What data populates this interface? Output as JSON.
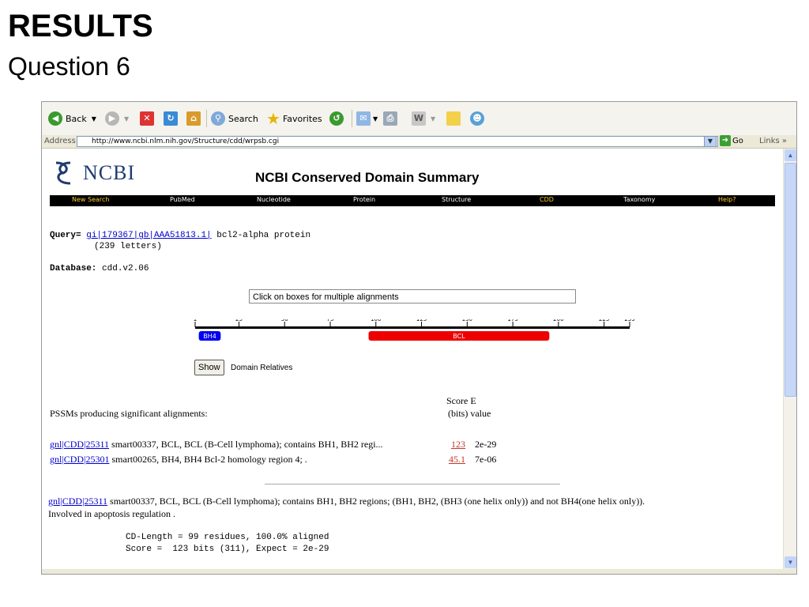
{
  "slide": {
    "title": "RESULTS",
    "subtitle": "Question 6"
  },
  "toolbar": {
    "back": "Back",
    "search": "Search",
    "favorites": "Favorites"
  },
  "address": {
    "label": "Address",
    "url": "http://www.ncbi.nlm.nih.gov/Structure/cdd/wrpsb.cgi",
    "go": "Go",
    "links": "Links"
  },
  "page": {
    "logo": "NCBI",
    "heading": "NCBI Conserved Domain Summary",
    "nav": [
      "New Search",
      "PubMed",
      "Nucleotide",
      "Protein",
      "Structure",
      "CDD",
      "Taxonomy",
      "Help?"
    ],
    "nav_active": "CDD",
    "query_label": "Query=",
    "query_link": "gi|179367|gb|AAA51813.1|",
    "query_desc": "bcl2-alpha protein",
    "query_len": "(239 letters)",
    "database_label": "Database:",
    "database_value": "cdd.v2.06",
    "info_box": "Click on boxes for multiple alignments",
    "ruler_ticks": [
      "1",
      "25",
      "50",
      "75",
      "100",
      "125",
      "150",
      "175",
      "200",
      "225",
      "239"
    ],
    "domains": [
      {
        "label": "BH4",
        "start": 3,
        "end": 15,
        "color": "#0000ee"
      },
      {
        "label": "BCL",
        "start": 96,
        "end": 195,
        "color": "#ee0000"
      }
    ],
    "show_button": "Show",
    "domain_relatives": "Domain Relatives",
    "score_header_1": "Score E",
    "score_header_2": "(bits) value",
    "pssm_label": "PSSMs producing significant alignments:",
    "hits": [
      {
        "link": "gnl|CDD|25311",
        "desc": "smart00337, BCL, BCL (B-Cell lymphoma); contains BH1, BH2 regi...",
        "score": "123",
        "evalue": "2e-29"
      },
      {
        "link": "gnl|CDD|25301",
        "desc": "smart00265, BH4, BH4 Bcl-2 homology region 4; .",
        "score": "45.1",
        "evalue": "7e-06"
      }
    ],
    "detail_link": "gnl|CDD|25311",
    "detail_desc": "smart00337, BCL, BCL (B-Cell lymphoma); contains BH1, BH2 regions; (BH1, BH2, (BH3 (one helix only)) and not BH4(one helix only)).",
    "detail_desc2": "Involved in apoptosis regulation .",
    "cd_length": "CD-Length = 99 residues, 100.0% aligned",
    "score_line": "Score =  123 bits (311), Expect = 2e-29"
  }
}
